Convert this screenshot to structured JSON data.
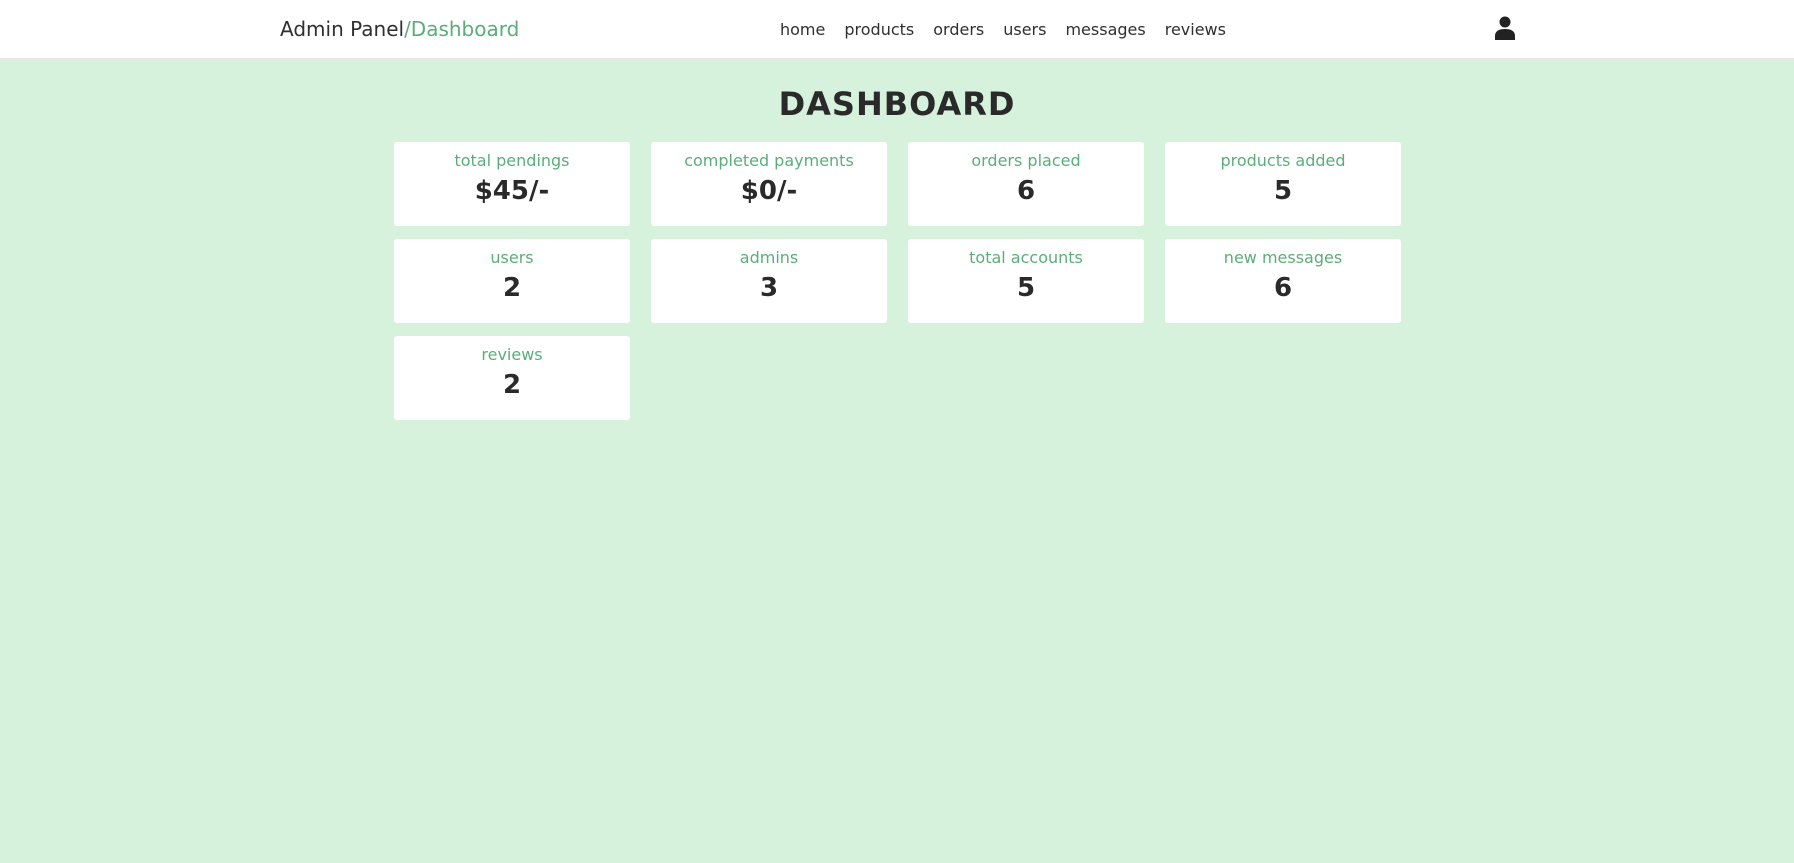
{
  "header": {
    "logo_main": "Admin Panel",
    "logo_accent": "/Dashboard",
    "nav": [
      "home",
      "products",
      "orders",
      "users",
      "messages",
      "reviews"
    ],
    "user_icon": "user-icon"
  },
  "page": {
    "title": "DASHBOARD"
  },
  "cards": [
    {
      "label": "total pendings",
      "value": "$45/-"
    },
    {
      "label": "completed payments",
      "value": "$0/-"
    },
    {
      "label": "orders placed",
      "value": "6"
    },
    {
      "label": "products added",
      "value": "5"
    },
    {
      "label": "users",
      "value": "2"
    },
    {
      "label": "admins",
      "value": "3"
    },
    {
      "label": "total accounts",
      "value": "5"
    },
    {
      "label": "new messages",
      "value": "6"
    },
    {
      "label": "reviews",
      "value": "2"
    }
  ],
  "colors": {
    "background": "#d7f2dc",
    "accent": "#5aae7a",
    "text": "#2a2a2a"
  }
}
